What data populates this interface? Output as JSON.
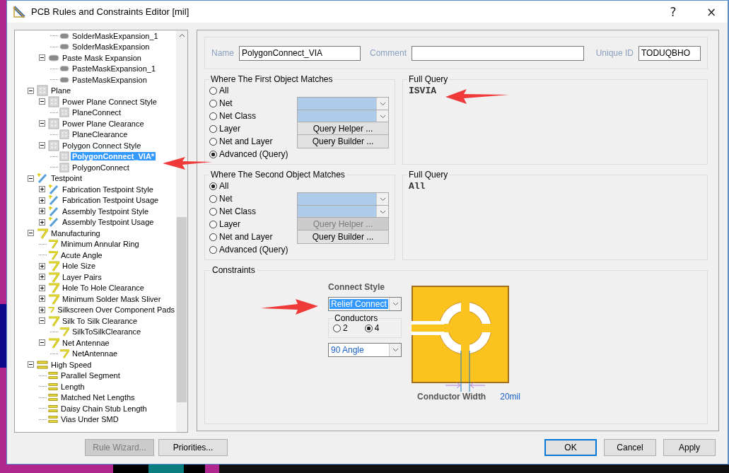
{
  "window": {
    "title": "PCB Rules and Constraints Editor [mil]",
    "help": "?",
    "close": "×"
  },
  "tree": {
    "items": [
      {
        "children": [
          {
            "children": [
              {
                "label": "SolderMaskExpansion_1",
                "kind": "mask",
                "selected": false
              },
              {
                "label": "SolderMaskExpansion",
                "kind": "mask",
                "selected": false
              }
            ]
          },
          {
            "label": "Paste Mask Expansion",
            "kind": "mask",
            "expanded": true,
            "selected": false,
            "children": [
              {
                "label": "PasteMaskExpansion_1",
                "kind": "mask",
                "selected": false
              },
              {
                "label": "PasteMaskExpansion",
                "kind": "mask",
                "selected": false
              }
            ]
          }
        ]
      },
      {
        "label": "Plane",
        "kind": "plane",
        "expanded": true,
        "selected": false,
        "children": [
          {
            "label": "Power Plane Connect Style",
            "kind": "plane",
            "expanded": true,
            "selected": false,
            "children": [
              {
                "label": "PlaneConnect",
                "kind": "plane",
                "selected": false
              }
            ]
          },
          {
            "label": "Power Plane Clearance",
            "kind": "plane",
            "expanded": true,
            "selected": false,
            "children": [
              {
                "label": "PlaneClearance",
                "kind": "plane",
                "selected": false
              }
            ]
          },
          {
            "label": "Polygon Connect Style",
            "kind": "plane",
            "expanded": true,
            "selected": false,
            "children": [
              {
                "label": "PolygonConnect_VIA*",
                "kind": "plane",
                "selected": true
              },
              {
                "label": "PolygonConnect",
                "kind": "plane",
                "selected": false
              }
            ]
          }
        ]
      },
      {
        "label": "Testpoint",
        "kind": "testpoint",
        "expanded": true,
        "selected": false,
        "children": [
          {
            "label": "Fabrication Testpoint Style",
            "kind": "testpoint",
            "expanded": false,
            "selected": false
          },
          {
            "label": "Fabrication Testpoint Usage",
            "kind": "testpoint",
            "expanded": false,
            "selected": false
          },
          {
            "label": "Assembly Testpoint Style",
            "kind": "testpoint",
            "expanded": false,
            "selected": false
          },
          {
            "label": "Assembly Testpoint Usage",
            "kind": "testpoint",
            "expanded": false,
            "selected": false
          }
        ]
      },
      {
        "label": "Manufacturing",
        "kind": "manufacturing",
        "expanded": true,
        "selected": false,
        "children": [
          {
            "label": "Minimum Annular Ring",
            "kind": "manufacturing",
            "selected": false
          },
          {
            "label": "Acute Angle",
            "kind": "manufacturing",
            "selected": false
          },
          {
            "label": "Hole Size",
            "kind": "manufacturing",
            "expanded": false,
            "selected": false
          },
          {
            "label": "Layer Pairs",
            "kind": "manufacturing",
            "expanded": false,
            "selected": false
          },
          {
            "label": "Hole To Hole Clearance",
            "kind": "manufacturing",
            "expanded": false,
            "selected": false
          },
          {
            "label": "Minimum Solder Mask Sliver",
            "kind": "manufacturing",
            "expanded": false,
            "selected": false
          },
          {
            "label": "Silkscreen Over Component Pads",
            "kind": "manufacturing",
            "expanded": false,
            "selected": false
          },
          {
            "label": "Silk To Silk Clearance",
            "kind": "manufacturing",
            "expanded": true,
            "selected": false,
            "children": [
              {
                "label": "SilkToSilkClearance",
                "kind": "manufacturing",
                "selected": false
              }
            ]
          },
          {
            "label": "Net Antennae",
            "kind": "manufacturing",
            "expanded": true,
            "selected": false,
            "children": [
              {
                "label": "NetAntennae",
                "kind": "manufacturing",
                "selected": false
              }
            ]
          }
        ]
      },
      {
        "label": "High Speed",
        "kind": "highspeed",
        "expanded": true,
        "selected": false,
        "children": [
          {
            "label": "Parallel Segment",
            "kind": "highspeed",
            "selected": false
          },
          {
            "label": "Length",
            "kind": "highspeed",
            "selected": false
          },
          {
            "label": "Matched Net Lengths",
            "kind": "highspeed",
            "selected": false
          },
          {
            "label": "Daisy Chain Stub Length",
            "kind": "highspeed",
            "selected": false
          },
          {
            "label": "Vias Under SMD",
            "kind": "highspeed",
            "selected": false
          }
        ]
      }
    ]
  },
  "rule": {
    "name_label": "Name",
    "name": "PolygonConnect_VIA",
    "comment_label": "Comment",
    "id_label": "Unique ID",
    "id": "TODUQBHO"
  },
  "matches": [
    {
      "title": "Where The First Object Matches",
      "options": [
        {
          "label": "All",
          "selected": false
        },
        {
          "label": "Net",
          "selected": false
        },
        {
          "label": "Net Class",
          "selected": false
        },
        {
          "label": "Layer",
          "selected": false
        },
        {
          "label": "Net and Layer",
          "selected": false
        },
        {
          "label": "Advanced (Query)",
          "selected": true
        }
      ],
      "dropdowns": [
        {
          "disabled": true
        },
        {
          "disabled": true
        }
      ],
      "buttons": [
        {
          "label": "Query Helper ...",
          "disabled": false
        },
        {
          "label": "Query Builder ...",
          "disabled": false
        }
      ],
      "query_title": "Full Query",
      "query": "ISVIA"
    },
    {
      "title": "Where The Second Object Matches",
      "options": [
        {
          "label": "All",
          "selected": true
        },
        {
          "label": "Net",
          "selected": false
        },
        {
          "label": "Net Class",
          "selected": false
        },
        {
          "label": "Layer",
          "selected": false
        },
        {
          "label": "Net and Layer",
          "selected": false
        },
        {
          "label": "Advanced (Query)",
          "selected": false
        }
      ],
      "dropdowns": [
        {
          "disabled": true
        },
        {
          "disabled": true
        }
      ],
      "buttons": [
        {
          "label": "Query Helper ...",
          "disabled": true
        },
        {
          "label": "Query Builder ...",
          "disabled": false
        }
      ],
      "query_title": "Full Query",
      "query": "All"
    }
  ],
  "constraints": {
    "title": "Constraints",
    "style_label": "Connect Style",
    "style": "Relief Connect",
    "conductors_title": "Conductors",
    "conductors": [
      {
        "label": "2",
        "selected": false
      },
      {
        "label": "4",
        "selected": true
      }
    ],
    "angle": "90 Angle",
    "width_label": "Conductor Width",
    "width": "20mil"
  },
  "buttons": {
    "left": [
      {
        "label": "Rule Wizard...",
        "disabled": true
      },
      {
        "label": "Priorities...",
        "disabled": false
      }
    ],
    "right": [
      {
        "label": "OK",
        "default": true
      },
      {
        "label": "Cancel",
        "default": false
      },
      {
        "label": "Apply",
        "default": false
      }
    ]
  }
}
